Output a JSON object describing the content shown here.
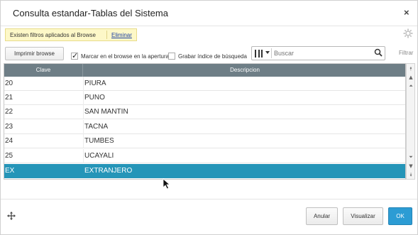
{
  "dialog": {
    "title": "Consulta estandar-Tablas del Sistema",
    "close_glyph": "×"
  },
  "filter_notice": {
    "text": "Existen filtros aplicados al Browse",
    "action_label": "Eliminar"
  },
  "toolbar": {
    "print_label": "Imprimir browse",
    "mark_in_browse_label": "Marcar en el browse en la apertura",
    "mark_in_browse_checked": true,
    "save_search_index_label": "Grabar índice de búsqueda",
    "save_search_index_checked": false,
    "search_placeholder": "Buscar",
    "filter_label": "Filtrar"
  },
  "grid": {
    "columns": [
      "Clave",
      "Descripcion"
    ],
    "rows": [
      {
        "clave": "20",
        "descripcion": "PIURA"
      },
      {
        "clave": "21",
        "descripcion": "PUNO"
      },
      {
        "clave": "22",
        "descripcion": "SAN MANTIN"
      },
      {
        "clave": "23",
        "descripcion": "TACNA"
      },
      {
        "clave": "24",
        "descripcion": "TUMBES"
      },
      {
        "clave": "25",
        "descripcion": "UCAYALI"
      },
      {
        "clave": "EX",
        "descripcion": "EXTRANJERO"
      }
    ],
    "selected_row_index": 6
  },
  "footer": {
    "cancel_label": "Anular",
    "view_label": "Visualizar",
    "ok_label": "OK"
  },
  "colors": {
    "header_bg": "#6e7e86",
    "selected_row": "#2595b8",
    "ok_button": "#2c9cd4",
    "filter_notice_bg": "#fdf8c8"
  },
  "icons": {
    "close": "close-icon",
    "settings": "gear-icon",
    "columns": "columns-icon",
    "search": "search-icon",
    "move": "move-icon"
  }
}
